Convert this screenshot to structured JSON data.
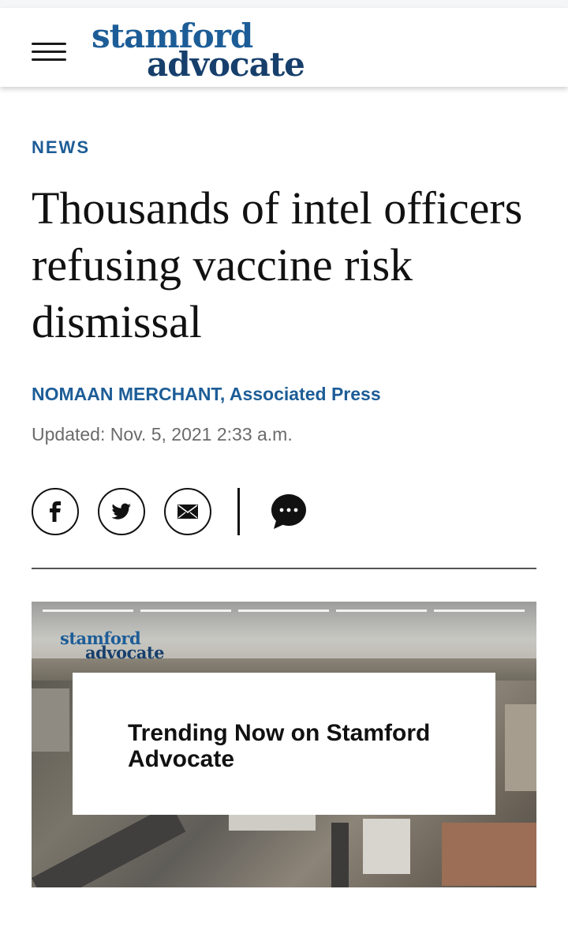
{
  "header": {
    "logo_line1": "stamford",
    "logo_line2": "advocate",
    "menu_icon": "hamburger-menu-icon"
  },
  "article": {
    "section": "NEWS",
    "headline": "Thousands of intel officers refusing vaccine risk dismissal",
    "byline": "NOMAAN MERCHANT, Associated Press",
    "updated": "Updated: Nov. 5, 2021 2:33 a.m."
  },
  "share": {
    "icons": [
      "facebook-icon",
      "twitter-icon",
      "email-icon",
      "comment-icon"
    ]
  },
  "video": {
    "logo_line1": "stamford",
    "logo_line2": "advocate",
    "card_text": "Trending Now on Stamford Advocate",
    "segments": 5
  },
  "colors": {
    "brand": "#1d5d97",
    "brand_dark": "#173f6c",
    "text": "#111111",
    "muted": "#6b6b6b"
  }
}
